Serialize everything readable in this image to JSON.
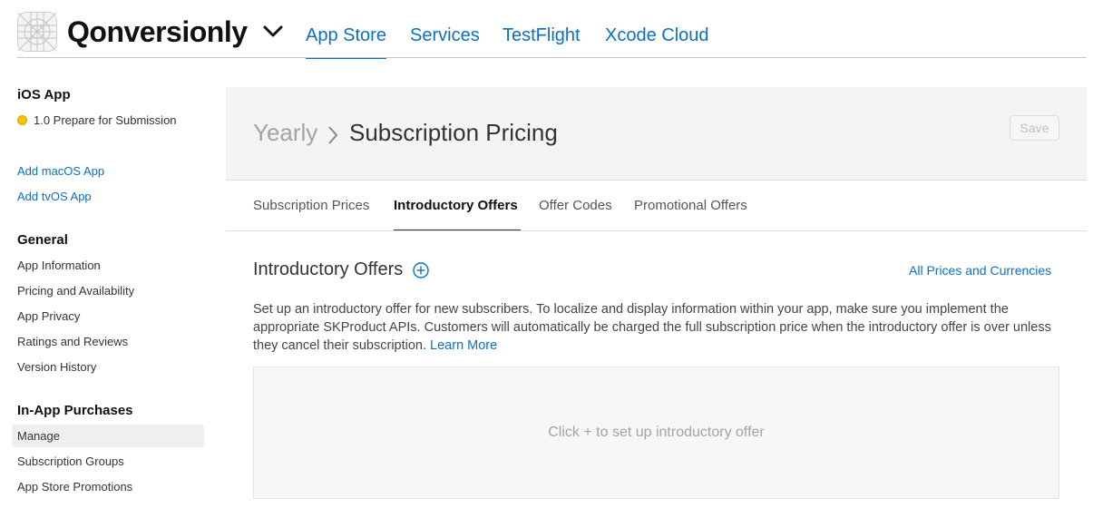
{
  "header": {
    "app_name": "Qonversionly",
    "app_icon": "app-icon-placeholder",
    "tabs": [
      {
        "label": "App Store",
        "active": true
      },
      {
        "label": "Services"
      },
      {
        "label": "TestFlight"
      },
      {
        "label": "Xcode Cloud"
      }
    ]
  },
  "sidebar": {
    "platform_heading": "iOS App",
    "version_status": "1.0 Prepare for Submission",
    "status_color": "#f5c500",
    "add_links": [
      "Add macOS App",
      "Add tvOS App"
    ],
    "general": {
      "heading": "General",
      "items": [
        "App Information",
        "Pricing and Availability",
        "App Privacy",
        "Ratings and Reviews",
        "Version History"
      ]
    },
    "iap": {
      "heading": "In-App Purchases",
      "items": [
        "Manage",
        "Subscription Groups",
        "App Store Promotions"
      ],
      "selected": "Manage"
    }
  },
  "main": {
    "breadcrumb_parent": "Yearly",
    "breadcrumb_current": "Subscription Pricing",
    "save_label": "Save",
    "sub_tabs": [
      {
        "label": "Subscription Prices"
      },
      {
        "label": "Introductory Offers",
        "active": true
      },
      {
        "label": "Offer Codes"
      },
      {
        "label": "Promotional Offers"
      }
    ],
    "section_title": "Introductory Offers",
    "all_prices_link": "All Prices and Currencies",
    "description": "Set up an introductory offer for new subscribers. To localize and display information within your app, make sure you implement the appropriate SKProduct APIs. Customers will automatically be charged the full subscription price when the introductory offer is over unless they cancel their subscription.",
    "learn_more": "Learn More",
    "empty_state": "Click + to set up introductory offer"
  },
  "colors": {
    "accent": "#0a70c4",
    "header_panel": "#f4f4f4"
  }
}
